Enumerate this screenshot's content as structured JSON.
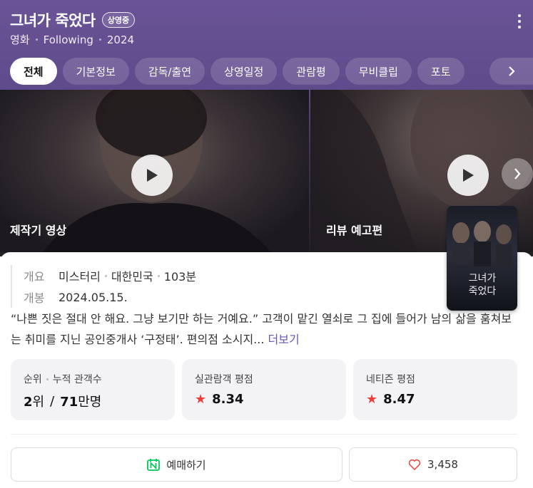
{
  "header": {
    "title": "그녀가 죽었다",
    "badge": "상영중",
    "meta": [
      "영화",
      "Following",
      "2024"
    ]
  },
  "tabs": [
    "전체",
    "기본정보",
    "감독/출연",
    "상영일정",
    "관람평",
    "무비클립",
    "포토"
  ],
  "videos": [
    {
      "title": "제작기 영상"
    },
    {
      "title": "리뷰 예고편"
    }
  ],
  "poster": {
    "title_lines": [
      "그녀가",
      "죽었다"
    ]
  },
  "info": {
    "genre_label": "개요",
    "genre": "미스터리",
    "country": "대한민국",
    "runtime": "103분",
    "release_label": "개봉",
    "release": "2024.05.15."
  },
  "description": {
    "text": "“나쁜 짓은 절대 안 해요. 그냥 보기만 하는 거예요.” 고객이 맡긴 열쇠로 그 집에 들어가 남의 삶을 훔쳐보는 취미를 지닌 공인중개사 ‘구정태’. 편의점 소시지...",
    "more": "더보기"
  },
  "stats": {
    "rank_label": "순위",
    "audience_label": "누적 관객수",
    "rank": "2",
    "rank_unit": "위",
    "slash": "/",
    "audience": "71",
    "audience_unit": "만명",
    "real_label": "실관람객 평점",
    "real_score": "8.34",
    "netizen_label": "네티즌 평점",
    "netizen_score": "8.47"
  },
  "actions": {
    "book": "예매하기",
    "likes": "3,458"
  },
  "colors": {
    "accent": "#6b54b5",
    "header": "#5f4b8b",
    "star": "#e8413c",
    "naver": "#03c75a"
  }
}
